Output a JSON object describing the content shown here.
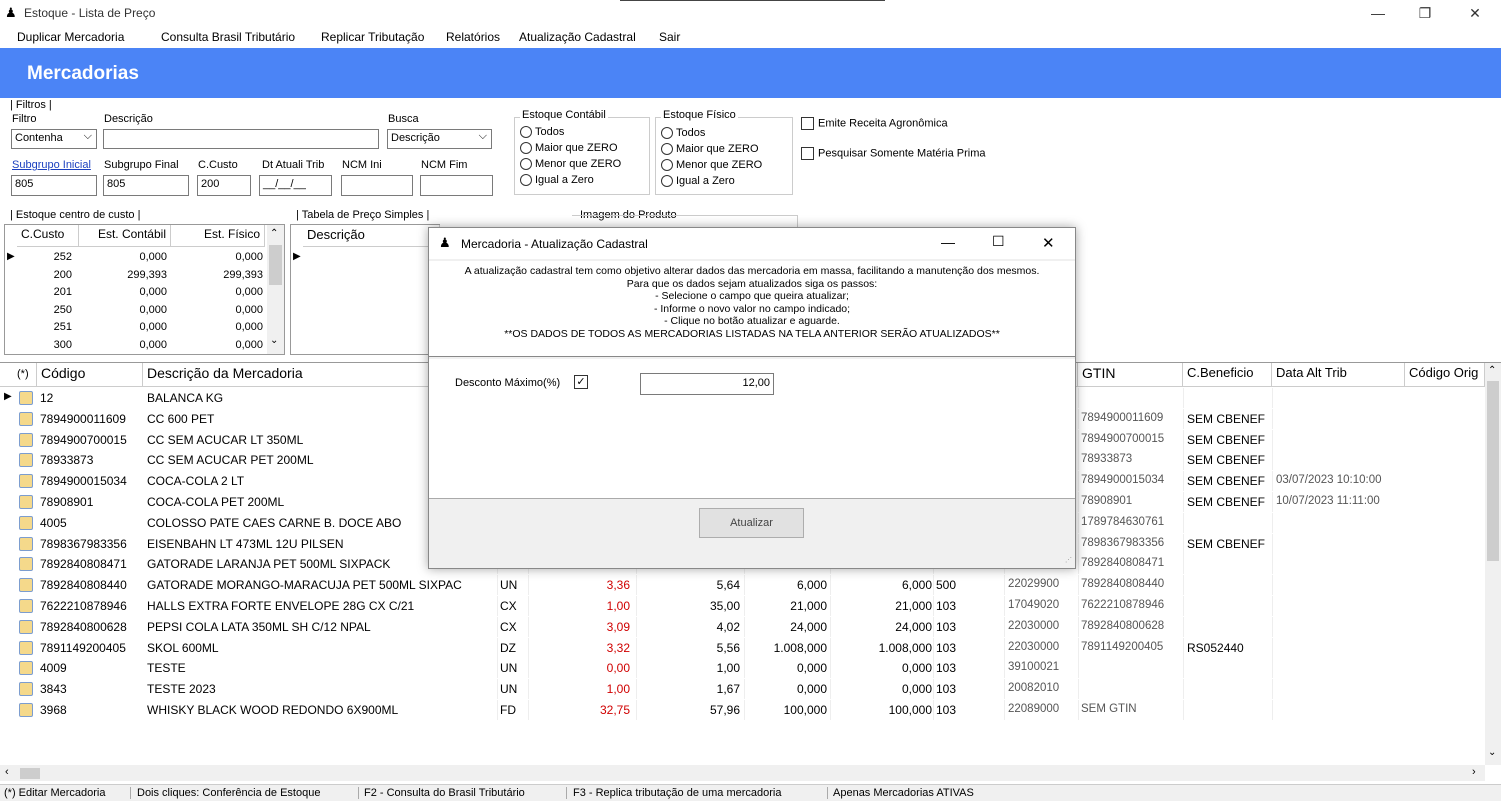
{
  "window": {
    "title": "Estoque - Lista de Preço"
  },
  "menu": [
    "Duplicar Mercadoria",
    "Consulta Brasil Tributário",
    "Replicar Tributação",
    "Relatórios",
    "Atualização Cadastral",
    "Sair"
  ],
  "banner": "Mercadorias",
  "filtros": {
    "legend": "| Filtros |",
    "filtro_label": "Filtro",
    "filtro_value": "Contenha",
    "descricao_label": "Descrição",
    "descricao_value": "",
    "busca_label": "Busca",
    "busca_value": "Descrição",
    "sub_ini_label": "Subgrupo Inicial",
    "sub_ini_value": "805",
    "sub_fim_label": "Subgrupo Final",
    "sub_fim_value": "805",
    "ccusto_label": "C.Custo",
    "ccusto_value": "200",
    "dt_label": "Dt Atuali Trib",
    "dt_value": "__/__/__",
    "ncm_ini_label": "NCM Ini",
    "ncm_ini_value": "",
    "ncm_fim_label": "NCM Fim",
    "ncm_fim_value": "",
    "est_contabil": {
      "legend": "Estoque Contábil",
      "options": [
        "Todos",
        "Maior que ZERO",
        "Menor que ZERO",
        "Igual a Zero"
      ]
    },
    "est_fisico": {
      "legend": "Estoque Físico",
      "options": [
        "Todos",
        "Maior que ZERO",
        "Menor que ZERO",
        "Igual a Zero"
      ]
    },
    "emite_receita": "Emite Receita Agronômica",
    "materia_prima": "Pesquisar Somente Matéria Prima"
  },
  "estoque_cc": {
    "legend": "| Estoque centro de custo |",
    "headers": [
      "C.Custo",
      "Est. Contábil",
      "Est. Físico"
    ],
    "rows": [
      [
        "252",
        "0,000",
        "0,000"
      ],
      [
        "200",
        "299,393",
        "299,393"
      ],
      [
        "201",
        "0,000",
        "0,000"
      ],
      [
        "250",
        "0,000",
        "0,000"
      ],
      [
        "251",
        "0,000",
        "0,000"
      ],
      [
        "300",
        "0,000",
        "0,000"
      ]
    ]
  },
  "tabela_preco": {
    "legend": "| Tabela de Preço Simples |",
    "header": "Descrição"
  },
  "imagem": {
    "legend": "Imagem do Produto"
  },
  "main_grid": {
    "headers": {
      "star": "(*)",
      "codigo": "Código",
      "descricao": "Descrição da Mercadoria",
      "gtin": "GTIN",
      "cbenef": "C.Beneficio",
      "data_alt": "Data Alt Trib",
      "codigo_ori": "Código Orig"
    },
    "rows": [
      {
        "codigo": "12",
        "desc": "BALANCA KG",
        "un": "",
        "custo": "",
        "venda": "",
        "estc": "",
        "estf": "",
        "grp": "",
        "ncm": "",
        "gtin": "",
        "cbenef": "",
        "data": ""
      },
      {
        "codigo": "7894900011609",
        "desc": "CC 600 PET",
        "un": "",
        "custo": "",
        "venda": "",
        "estc": "",
        "estf": "",
        "grp": "",
        "ncm": "",
        "gtin": "7894900011609",
        "cbenef": "SEM CBENEF",
        "data": ""
      },
      {
        "codigo": "7894900700015",
        "desc": "CC SEM ACUCAR LT 350ML",
        "un": "",
        "custo": "",
        "venda": "",
        "estc": "",
        "estf": "",
        "grp": "",
        "ncm": "",
        "gtin": "7894900700015",
        "cbenef": "SEM CBENEF",
        "data": ""
      },
      {
        "codigo": "78933873",
        "desc": "CC SEM ACUCAR PET 200ML",
        "un": "",
        "custo": "",
        "venda": "",
        "estc": "",
        "estf": "",
        "grp": "",
        "ncm": "",
        "gtin": "78933873",
        "cbenef": "SEM CBENEF",
        "data": ""
      },
      {
        "codigo": "7894900015034",
        "desc": "COCA-COLA 2 LT",
        "un": "",
        "custo": "",
        "venda": "",
        "estc": "",
        "estf": "",
        "grp": "",
        "ncm": "",
        "gtin": "7894900015034",
        "cbenef": "SEM CBENEF",
        "data": "03/07/2023 10:10:00"
      },
      {
        "codigo": "78908901",
        "desc": "COCA-COLA PET 200ML",
        "un": "",
        "custo": "",
        "venda": "",
        "estc": "",
        "estf": "",
        "grp": "",
        "ncm": "",
        "gtin": "78908901",
        "cbenef": "SEM CBENEF",
        "data": "10/07/2023 11:11:00"
      },
      {
        "codigo": "4005",
        "desc": "COLOSSO PATE CAES CARNE B. DOCE ABO",
        "un": "",
        "custo": "",
        "venda": "",
        "estc": "",
        "estf": "",
        "grp": "",
        "ncm": "",
        "gtin": "1789784630761",
        "cbenef": "",
        "data": ""
      },
      {
        "codigo": "7898367983356",
        "desc": "EISENBAHN LT 473ML 12U PILSEN",
        "un": "",
        "custo": "",
        "venda": "",
        "estc": "",
        "estf": "",
        "grp": "",
        "ncm": "",
        "gtin": "7898367983356",
        "cbenef": "SEM CBENEF",
        "data": ""
      },
      {
        "codigo": "7892840808471",
        "desc": "GATORADE LARANJA PET 500ML SIXPACK",
        "un": "",
        "custo": "",
        "venda": "",
        "estc": "",
        "estf": "",
        "grp": "",
        "ncm": "",
        "gtin": "7892840808471",
        "cbenef": "",
        "data": ""
      },
      {
        "codigo": "7892840808440",
        "desc": "GATORADE MORANGO-MARACUJA PET 500ML SIXPAC",
        "un": "UN",
        "custo": "3,36",
        "venda": "5,64",
        "estc": "6,000",
        "estf": "6,000",
        "grp": "500",
        "ncm": "22029900",
        "gtin": "7892840808440",
        "cbenef": "",
        "data": ""
      },
      {
        "codigo": "7622210878946",
        "desc": "HALLS EXTRA FORTE ENVELOPE 28G CX C/21",
        "un": "CX",
        "custo": "1,00",
        "venda": "35,00",
        "estc": "21,000",
        "estf": "21,000",
        "grp": "103",
        "ncm": "17049020",
        "gtin": "7622210878946",
        "cbenef": "",
        "data": ""
      },
      {
        "codigo": "7892840800628",
        "desc": "PEPSI COLA LATA 350ML SH C/12 NPAL",
        "un": "CX",
        "custo": "3,09",
        "venda": "4,02",
        "estc": "24,000",
        "estf": "24,000",
        "grp": "103",
        "ncm": "22030000",
        "gtin": "7892840800628",
        "cbenef": "",
        "data": ""
      },
      {
        "codigo": "7891149200405",
        "desc": "SKOL 600ML",
        "un": "DZ",
        "custo": "3,32",
        "venda": "5,56",
        "estc": "1.008,000",
        "estf": "1.008,000",
        "grp": "103",
        "ncm": "22030000",
        "gtin": "7891149200405",
        "cbenef": "RS052440",
        "data": ""
      },
      {
        "codigo": "4009",
        "desc": "TESTE",
        "un": "UN",
        "custo": "0,00",
        "venda": "1,00",
        "estc": "0,000",
        "estf": "0,000",
        "grp": "103",
        "ncm": "39100021",
        "gtin": "",
        "cbenef": "",
        "data": ""
      },
      {
        "codigo": "3843",
        "desc": "TESTE 2023",
        "un": "UN",
        "custo": "1,00",
        "venda": "1,67",
        "estc": "0,000",
        "estf": "0,000",
        "grp": "103",
        "ncm": "20082010",
        "gtin": "",
        "cbenef": "",
        "data": ""
      },
      {
        "codigo": "3968",
        "desc": "WHISKY BLACK WOOD REDONDO 6X900ML",
        "un": "FD",
        "custo": "32,75",
        "venda": "57,96",
        "estc": "100,000",
        "estf": "100,000",
        "grp": "103",
        "ncm": "22089000",
        "gtin": "SEM GTIN",
        "cbenef": "",
        "data": ""
      }
    ]
  },
  "dialog": {
    "title": "Mercadoria - Atualização Cadastral",
    "info": [
      "A atualização cadastral tem como objetivo alterar dados das mercadoria em massa, facilitando a manutenção dos mesmos.",
      "Para que os dados sejam atualizados siga os passos:",
      "- Selecione o campo que queira atualizar;",
      "- Informe o novo valor no campo indicado;",
      "- Clique no botão atualizar e aguarde.",
      "**OS DADOS DE TODOS AS MERCADORIAS LISTADAS NA TELA ANTERIOR SERÃO ATUALIZADOS**"
    ],
    "field_label": "Desconto Máximo(%)",
    "field_value": "12,00",
    "button": "Atualizar"
  },
  "status": [
    "(*) Editar Mercadoria",
    "Dois cliques: Conferência de Estoque",
    "F2 - Consulta do Brasil Tributário",
    "F3 - Replica tributação de uma mercadoria",
    "Apenas Mercadorias ATIVAS"
  ]
}
